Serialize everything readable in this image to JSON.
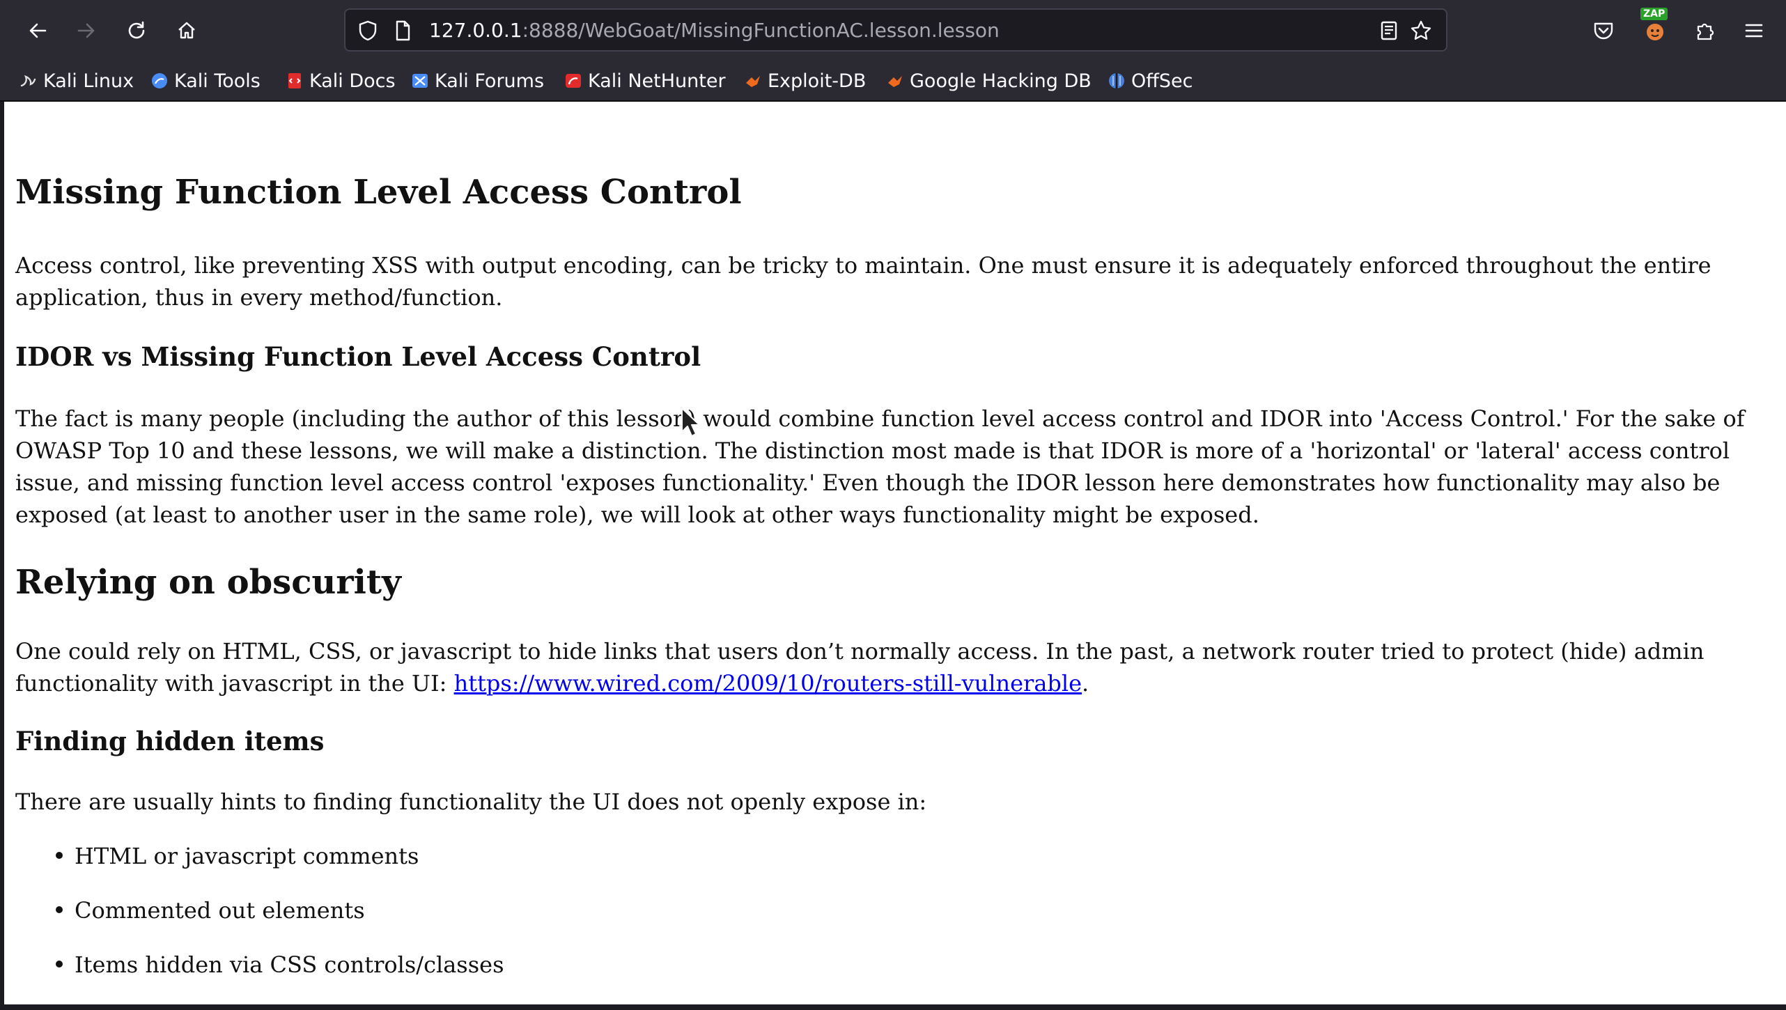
{
  "browser": {
    "url_host": "127.0.0.1",
    "url_rest": ":8888/WebGoat/MissingFunctionAC.lesson.lesson",
    "zap_badge": "ZAP"
  },
  "bookmarks": [
    {
      "label": "Kali Linux",
      "icon": "kali-dragon-icon",
      "color": "#e0e0e0"
    },
    {
      "label": "Kali Tools",
      "icon": "kali-tools-icon",
      "color": "#4a8cf7"
    },
    {
      "label": "Kali Docs",
      "icon": "kali-docs-icon",
      "color": "#e22b2b"
    },
    {
      "label": "Kali Forums",
      "icon": "kali-forums-icon",
      "color": "#4a8cf7"
    },
    {
      "label": "Kali NetHunter",
      "icon": "kali-nethunter-icon",
      "color": "#e22b2b"
    },
    {
      "label": "Exploit-DB",
      "icon": "exploit-db-icon",
      "color": "#f06a1d"
    },
    {
      "label": "Google Hacking DB",
      "icon": "ghdb-icon",
      "color": "#f06a1d"
    },
    {
      "label": "OffSec",
      "icon": "offsec-icon",
      "color": "#4a7fd8"
    }
  ],
  "content": {
    "h1_title": "Missing Function Level Access Control",
    "intro": "Access control, like preventing XSS with output encoding, can be tricky to maintain. One must ensure it is adequately enforced throughout the entire application, thus in every method/function.",
    "h3_idor": "IDOR vs Missing Function Level Access Control",
    "idor_text": "The fact is many people (including the author of this lesson) would combine function level access control and IDOR into 'Access Control.' For the sake of OWASP Top 10 and these lessons, we will make a distinction. The distinction most made is that IDOR is more of a 'horizontal' or 'lateral' access control issue, and missing function level access control 'exposes functionality.' Even though the IDOR lesson here demonstrates how functionality may also be exposed (at least to another user in the same role), we will look at other ways functionality might be exposed.",
    "h1_obscurity": "Relying on obscurity",
    "obscurity_text": "One could rely on HTML, CSS, or javascript to hide links that users don’t normally access. In the past, a network router tried to protect (hide) admin functionality with javascript in the UI: ",
    "obscurity_link": "https://www.wired.com/2009/10/routers-still-vulnerable",
    "obscurity_end": ".",
    "h3_hidden": "Finding hidden items",
    "hidden_text": "There are usually hints to finding functionality the UI does not openly expose in:",
    "hidden_items": [
      "HTML or javascript comments",
      "Commented out elements",
      "Items hidden via CSS controls/classes"
    ]
  }
}
